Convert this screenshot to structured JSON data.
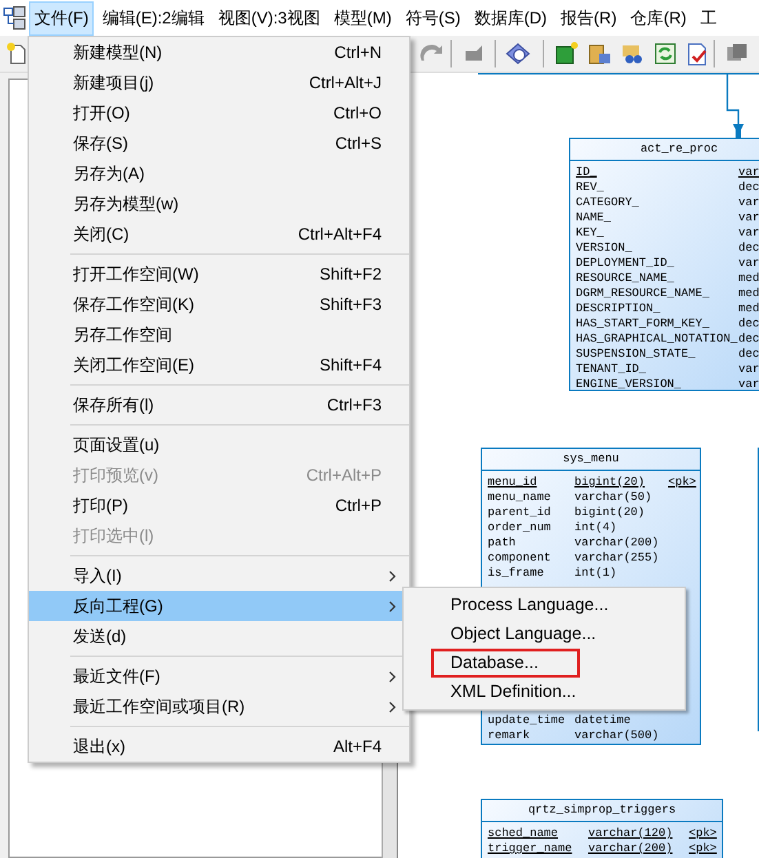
{
  "menubar": [
    {
      "label": "文件(F)",
      "selected": true
    },
    {
      "label": "编辑(E):2编辑",
      "selected": false
    },
    {
      "label": "视图(V):3视图",
      "selected": false
    },
    {
      "label": "模型(M)",
      "selected": false
    },
    {
      "label": "符号(S)",
      "selected": false
    },
    {
      "label": "数据库(D)",
      "selected": false
    },
    {
      "label": "报告(R)",
      "selected": false
    },
    {
      "label": "仓库(R)",
      "selected": false
    },
    {
      "label": "工",
      "selected": false
    }
  ],
  "file_menu": [
    {
      "kind": "item",
      "label": "新建模型(N)",
      "shortcut": "Ctrl+N",
      "disabled": false,
      "selected": false,
      "has_submenu": false
    },
    {
      "kind": "item",
      "label": "新建项目(j)",
      "shortcut": "Ctrl+Alt+J",
      "disabled": false,
      "selected": false,
      "has_submenu": false
    },
    {
      "kind": "item",
      "label": "打开(O)",
      "shortcut": "Ctrl+O",
      "disabled": false,
      "selected": false,
      "has_submenu": false
    },
    {
      "kind": "item",
      "label": "保存(S)",
      "shortcut": "Ctrl+S",
      "disabled": false,
      "selected": false,
      "has_submenu": false
    },
    {
      "kind": "item",
      "label": "另存为(A)",
      "disabled": false,
      "selected": false,
      "has_submenu": false
    },
    {
      "kind": "item",
      "label": "另存为模型(w)",
      "disabled": false,
      "selected": false,
      "has_submenu": false
    },
    {
      "kind": "item",
      "label": "关闭(C)",
      "shortcut": "Ctrl+Alt+F4",
      "disabled": false,
      "selected": false,
      "has_submenu": false
    },
    {
      "kind": "separator"
    },
    {
      "kind": "item",
      "label": "打开工作空间(W)",
      "shortcut": "Shift+F2",
      "disabled": false,
      "selected": false,
      "has_submenu": false
    },
    {
      "kind": "item",
      "label": "保存工作空间(K)",
      "shortcut": "Shift+F3",
      "disabled": false,
      "selected": false,
      "has_submenu": false
    },
    {
      "kind": "item",
      "label": "另存工作空间",
      "disabled": false,
      "selected": false,
      "has_submenu": false
    },
    {
      "kind": "item",
      "label": "关闭工作空间(E)",
      "shortcut": "Shift+F4",
      "disabled": false,
      "selected": false,
      "has_submenu": false
    },
    {
      "kind": "separator"
    },
    {
      "kind": "item",
      "label": "保存所有(l)",
      "shortcut": "Ctrl+F3",
      "disabled": false,
      "selected": false,
      "has_submenu": false
    },
    {
      "kind": "separator"
    },
    {
      "kind": "item",
      "label": "页面设置(u)",
      "disabled": false,
      "selected": false,
      "has_submenu": false
    },
    {
      "kind": "item",
      "label": "打印预览(v)",
      "shortcut": "Ctrl+Alt+P",
      "disabled": true,
      "selected": false,
      "has_submenu": false
    },
    {
      "kind": "item",
      "label": "打印(P)",
      "shortcut": "Ctrl+P",
      "disabled": false,
      "selected": false,
      "has_submenu": false
    },
    {
      "kind": "item",
      "label": "打印选中(l)",
      "disabled": true,
      "selected": false,
      "has_submenu": false
    },
    {
      "kind": "separator"
    },
    {
      "kind": "item",
      "label": "导入(I)",
      "disabled": false,
      "selected": false,
      "has_submenu": true
    },
    {
      "kind": "item",
      "label": "反向工程(G)",
      "disabled": false,
      "selected": true,
      "has_submenu": true
    },
    {
      "kind": "item",
      "label": "发送(d)",
      "disabled": false,
      "selected": false,
      "has_submenu": false
    },
    {
      "kind": "separator"
    },
    {
      "kind": "item",
      "label": "最近文件(F)",
      "disabled": false,
      "selected": false,
      "has_submenu": true
    },
    {
      "kind": "item",
      "label": "最近工作空间或项目(R)",
      "disabled": false,
      "selected": false,
      "has_submenu": true
    },
    {
      "kind": "separator"
    },
    {
      "kind": "item",
      "label": "退出(x)",
      "shortcut": "Alt+F4",
      "disabled": false,
      "selected": false,
      "has_submenu": false
    }
  ],
  "submenu": [
    {
      "label": "Process Language...",
      "highlighted": false
    },
    {
      "label": "Object Language...",
      "highlighted": false
    },
    {
      "label": "Database...",
      "highlighted": true
    },
    {
      "label": "XML Definition...",
      "highlighted": false
    }
  ],
  "tables": [
    {
      "title": "act_re_proc",
      "rows": [
        {
          "name": "ID_",
          "type": "var",
          "primary": true
        },
        {
          "name": "REV_",
          "type": "dec",
          "primary": false
        },
        {
          "name": "CATEGORY_",
          "type": "var",
          "primary": false
        },
        {
          "name": "NAME_",
          "type": "var",
          "primary": false
        },
        {
          "name": "KEY_",
          "type": "var",
          "primary": false
        },
        {
          "name": "VERSION_",
          "type": "dec",
          "primary": false
        },
        {
          "name": "DEPLOYMENT_ID_",
          "type": "var",
          "primary": false
        },
        {
          "name": "RESOURCE_NAME_",
          "type": "med",
          "primary": false
        },
        {
          "name": "DGRM_RESOURCE_NAME_",
          "type": "med",
          "primary": false
        },
        {
          "name": "DESCRIPTION_",
          "type": "med",
          "primary": false
        },
        {
          "name": "HAS_START_FORM_KEY_",
          "type": "dec",
          "primary": false
        },
        {
          "name": "HAS_GRAPHICAL_NOTATION_",
          "type": "dec",
          "primary": false
        },
        {
          "name": "SUSPENSION_STATE_",
          "type": "dec",
          "primary": false
        },
        {
          "name": "TENANT_ID_",
          "type": "var",
          "primary": false
        },
        {
          "name": "ENGINE_VERSION_",
          "type": "var",
          "primary": false
        }
      ]
    },
    {
      "title": "sys_menu",
      "rows": [
        {
          "name": "menu_id",
          "type": "bigint(20)",
          "key": "<pk>",
          "primary": true
        },
        {
          "name": "menu_name",
          "type": "varchar(50)",
          "primary": false
        },
        {
          "name": "parent_id",
          "type": "bigint(20)",
          "primary": false
        },
        {
          "name": "order_num",
          "type": "int(4)",
          "primary": false
        },
        {
          "name": "path",
          "type": "varchar(200)",
          "primary": false
        },
        {
          "name": "component",
          "type": "varchar(255)",
          "primary": false
        },
        {
          "name": "is_frame",
          "type": "int(1)",
          "primary": false
        }
      ],
      "rows_after_menu": [
        {
          "name": "update_time",
          "type": "datetime",
          "primary": false
        },
        {
          "name": "remark",
          "type": "varchar(500)",
          "primary": false
        }
      ]
    },
    {
      "title": "qrtz_simprop_triggers",
      "rows": [
        {
          "name": "sched_name",
          "type": "varchar(120)",
          "key": "<pk>",
          "primary": true
        },
        {
          "name": "trigger_name",
          "type": "varchar(200)",
          "key": "<pk>",
          "primary": true
        }
      ]
    }
  ]
}
